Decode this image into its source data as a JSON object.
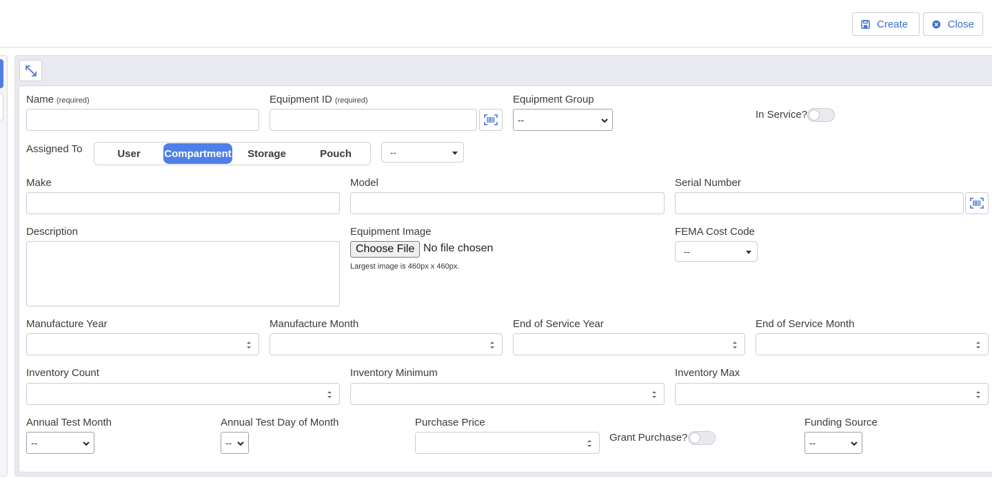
{
  "toolbar": {
    "create_label": "Create",
    "close_label": "Close",
    "accent": "#3c6fc8"
  },
  "form": {
    "name": {
      "label": "Name",
      "hint": "(required)"
    },
    "equipment_id": {
      "label": "Equipment ID",
      "hint": "(required)"
    },
    "equipment_group": {
      "label": "Equipment Group",
      "value": "--"
    },
    "in_service": {
      "label": "In Service?"
    },
    "assigned_to": {
      "label": "Assigned To",
      "options": [
        "User",
        "Compartment",
        "Storage",
        "Pouch"
      ],
      "selected": "Compartment",
      "target_value": "--"
    },
    "make": {
      "label": "Make"
    },
    "model": {
      "label": "Model"
    },
    "serial_number": {
      "label": "Serial Number"
    },
    "description": {
      "label": "Description"
    },
    "equipment_image": {
      "label": "Equipment Image",
      "button": "Choose File",
      "status": "No file chosen",
      "hint": "Largest image is 460px x 460px."
    },
    "fema_cost_code": {
      "label": "FEMA Cost Code",
      "value": "--"
    },
    "manufacture_year": {
      "label": "Manufacture Year"
    },
    "manufacture_month": {
      "label": "Manufacture Month"
    },
    "end_of_service_year": {
      "label": "End of Service Year"
    },
    "end_of_service_month": {
      "label": "End of Service Month"
    },
    "inventory_count": {
      "label": "Inventory Count"
    },
    "inventory_minimum": {
      "label": "Inventory Minimum"
    },
    "inventory_max": {
      "label": "Inventory Max"
    },
    "annual_test_month": {
      "label": "Annual Test Month",
      "value": "--"
    },
    "annual_test_day": {
      "label": "Annual Test Day of Month",
      "value": "--"
    },
    "purchase_price": {
      "label": "Purchase Price"
    },
    "grant_purchase": {
      "label": "Grant Purchase?"
    },
    "funding_source": {
      "label": "Funding Source",
      "value": "--"
    }
  },
  "icons": {
    "create": "save-icon",
    "close": "close-circle-icon",
    "expand": "expand-icon",
    "barcode": "barcode-scan-icon"
  }
}
